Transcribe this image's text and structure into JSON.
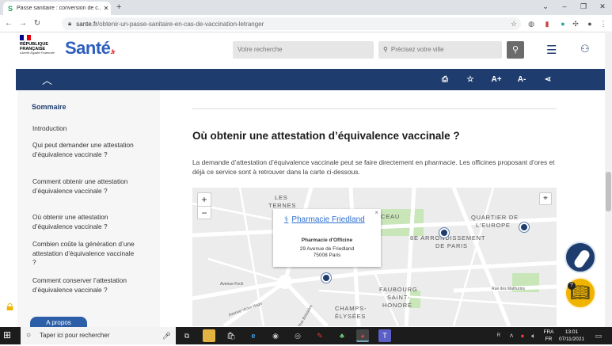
{
  "browser": {
    "tab_title": "Passe sanitaire : conversion de c...",
    "tab_favicon": "S",
    "url_domain": "sante.fr",
    "url_path": "/obtenir-un-passe-sanitaire-en-cas-de-vaccination-letranger"
  },
  "header": {
    "rf_line1": "RÉPUBLIQUE",
    "rf_line2": "FRANÇAISE",
    "rf_motto": "Liberté Égalité Fraternité",
    "logo": "Santé",
    "logo_suffix": ".fr",
    "search_placeholder": "Votre recherche",
    "city_placeholder": "Précisez votre ville"
  },
  "toolbar": {
    "font_increase": "A+",
    "font_decrease": "A-"
  },
  "sidebar": {
    "title": "Sommaire",
    "items": [
      "Introduction",
      "Qui peut demander une attestation d’équivalence vaccinale ?",
      "Comment obtenir une attestation d’équivalence vaccinale ?",
      "Où obtenir une attestation d’équivalence vaccinale ?",
      "Combien coûte la génération d’une attestation d’équivalence vaccinale ?",
      "Comment conserver l’attestation d’équivalence vaccinale ?"
    ],
    "apropos": "A propos"
  },
  "main": {
    "heading": "Où obtenir une attestation d’équivalence vaccinale ?",
    "paragraph": "La demande d’attestation d’équivalence vaccinale peut se faire directement en pharmacie. Les officines proposant d’ores et déjà ce service sont à retrouver dans la carte ci-dessous."
  },
  "map": {
    "zoom_in": "+",
    "zoom_out": "−",
    "popup": {
      "title": "Pharmacie Friedland",
      "type": "Pharmacie d'Officine",
      "address1": "29 Avenue de Friedland",
      "address2": "75008 Paris"
    },
    "labels": {
      "les_ternes_1": "LES",
      "les_ternes_2": "TERNES",
      "monceau": "CEAU",
      "quartier_1": "QUARTIER DE",
      "quartier_2": "L'EUROPE",
      "arr_1": "8E ARRONDISSEMENT",
      "arr_2": "DE PARIS",
      "faubourg_1": "FAUBOURG",
      "faubourg_2": "SAINT-",
      "faubourg_3": "HONORÉ",
      "champs_1": "CHAMPS-",
      "champs_2": "ÉLYSÉES",
      "avenue_foch": "Avenue Foch",
      "victor_hugo": "Avenue Victor Hugo",
      "mathurins": "Rue des Mathurins",
      "boissiere": "Rue Boissière"
    }
  },
  "taskbar": {
    "search_placeholder": "Taper ici pour rechercher",
    "lang1": "FRA",
    "lang2": "FR",
    "time": "13:01",
    "date": "07/11/2021"
  },
  "colors": {
    "navy": "#1e3d6e",
    "accent_yellow": "#f0b400",
    "link": "#2d6fd0"
  }
}
